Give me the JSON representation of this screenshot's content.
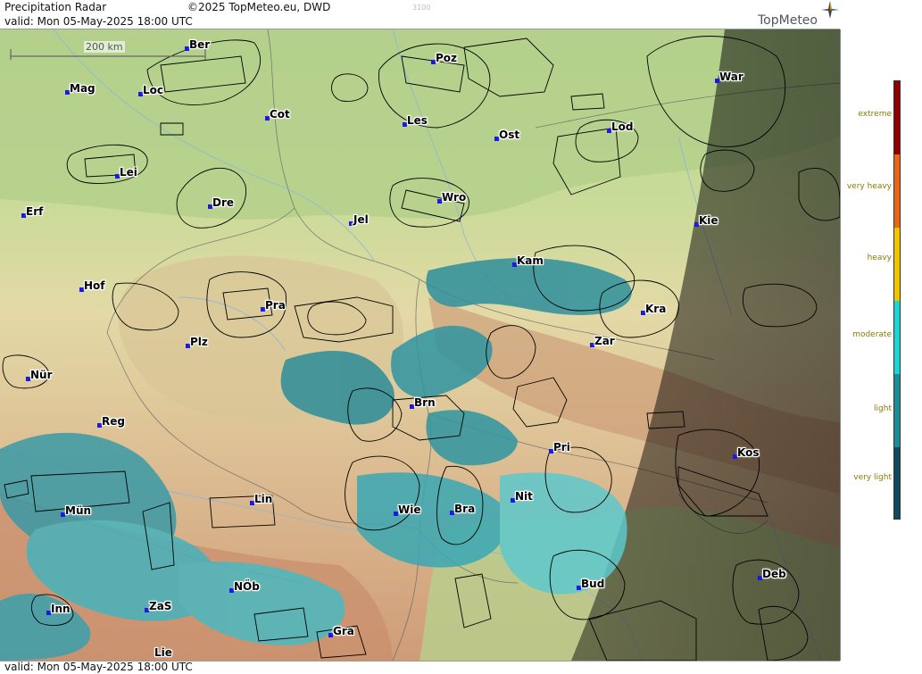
{
  "header": {
    "product": "Precipitation Radar",
    "copyright": "©2025 TopMeteo.eu, DWD",
    "code": "3100",
    "valid": "valid:  Mon  05-May-2025 18:00 UTC",
    "logo": "TopMeteo"
  },
  "footer": {
    "valid": "valid:  Mon  05-May-2025 18:00 UTC"
  },
  "scale": {
    "label": "200 km"
  },
  "colors": {
    "land_low": "#b7d38f",
    "land_mid": "#e3d9a6",
    "land_high": "#d7a47d",
    "night_shade": "#3a3a3a",
    "city_dot": "#1a1ae6",
    "precip_light": "#2fb3bb",
    "precip_very_light": "#3a8fa0"
  },
  "legend": {
    "items": [
      {
        "label": "extreme",
        "color": "#8b0000"
      },
      {
        "label": "very heavy",
        "color": "#e8661a"
      },
      {
        "label": "heavy",
        "color": "#f2c400"
      },
      {
        "label": "moderate",
        "color": "#22d3d3"
      },
      {
        "label": "light",
        "color": "#1e8c96"
      },
      {
        "label": "very light",
        "color": "#114a5a"
      }
    ]
  },
  "cities": [
    {
      "id": "ber",
      "name": "Ber"
    },
    {
      "id": "poz",
      "name": "Poz"
    },
    {
      "id": "war",
      "name": "War"
    },
    {
      "id": "mag",
      "name": "Mag"
    },
    {
      "id": "loc",
      "name": "Loc"
    },
    {
      "id": "cot",
      "name": "Cot"
    },
    {
      "id": "les",
      "name": "Les"
    },
    {
      "id": "lod",
      "name": "Lod"
    },
    {
      "id": "ost",
      "name": "Ost"
    },
    {
      "id": "lei",
      "name": "Lei"
    },
    {
      "id": "dre",
      "name": "Dre"
    },
    {
      "id": "wro",
      "name": "Wro"
    },
    {
      "id": "erf",
      "name": "Erf"
    },
    {
      "id": "jel",
      "name": "Jel"
    },
    {
      "id": "kie",
      "name": "Kie"
    },
    {
      "id": "kam",
      "name": "Kam"
    },
    {
      "id": "hof",
      "name": "Hof"
    },
    {
      "id": "pra",
      "name": "Pra"
    },
    {
      "id": "kra",
      "name": "Kra"
    },
    {
      "id": "plz",
      "name": "Plz"
    },
    {
      "id": "zar",
      "name": "Zar"
    },
    {
      "id": "nur",
      "name": "Nür"
    },
    {
      "id": "brn",
      "name": "Brn"
    },
    {
      "id": "reg",
      "name": "Reg"
    },
    {
      "id": "pri",
      "name": "Pri"
    },
    {
      "id": "kos",
      "name": "Kos"
    },
    {
      "id": "lin",
      "name": "Lin"
    },
    {
      "id": "nit",
      "name": "Nit"
    },
    {
      "id": "mun",
      "name": "Mün"
    },
    {
      "id": "wie",
      "name": "Wie"
    },
    {
      "id": "bra",
      "name": "Bra"
    },
    {
      "id": "bud",
      "name": "Bud"
    },
    {
      "id": "deb",
      "name": "Deb"
    },
    {
      "id": "nob",
      "name": "NÖb"
    },
    {
      "id": "inn",
      "name": "Inn"
    },
    {
      "id": "zas",
      "name": "ZaS"
    },
    {
      "id": "gra",
      "name": "Gra"
    },
    {
      "id": "lie",
      "name": "Lie"
    }
  ]
}
